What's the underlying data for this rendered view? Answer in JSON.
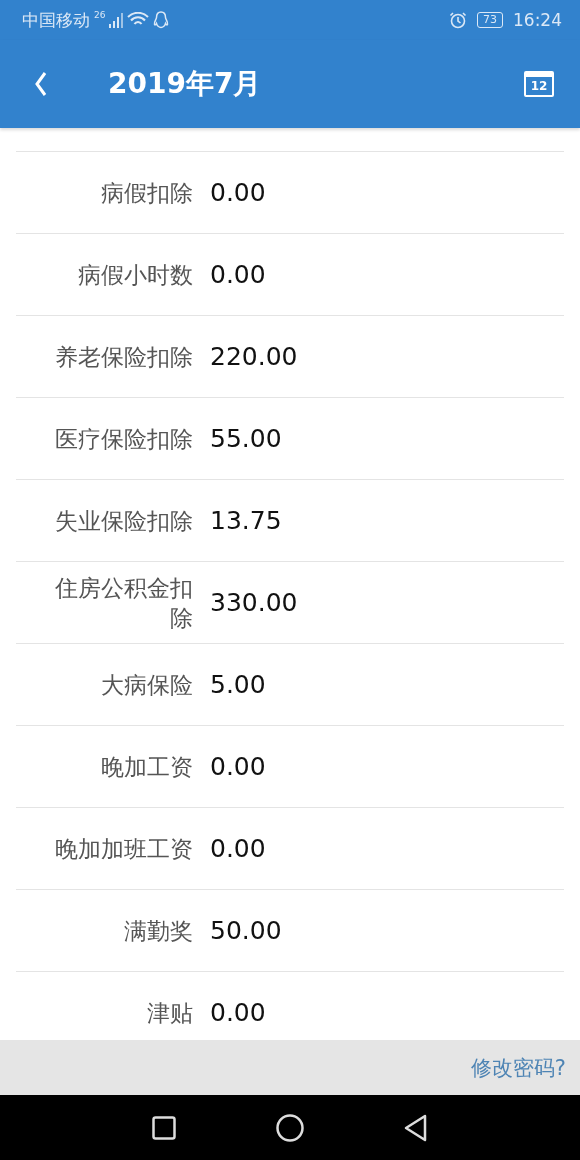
{
  "status_bar": {
    "carrier": "中国移动",
    "network": "26",
    "battery": "73",
    "time": "16:24"
  },
  "header": {
    "title": "2019年7月",
    "calendar_day": "12"
  },
  "rows": [
    {
      "label": "病假扣除",
      "value": "0.00"
    },
    {
      "label": "病假小时数",
      "value": "0.00"
    },
    {
      "label": "养老保险扣除",
      "value": "220.00"
    },
    {
      "label": "医疗保险扣除",
      "value": "55.00"
    },
    {
      "label": "失业保险扣除",
      "value": "13.75"
    },
    {
      "label": "住房公积金扣除",
      "value": "330.00"
    },
    {
      "label": "大病保险",
      "value": "5.00"
    },
    {
      "label": "晚加工资",
      "value": "0.00"
    },
    {
      "label": "晚加加班工资",
      "value": "0.00"
    },
    {
      "label": "满勤奖",
      "value": "50.00"
    },
    {
      "label": "津贴",
      "value": "0.00"
    }
  ],
  "footer": {
    "link": "修改密码?"
  }
}
